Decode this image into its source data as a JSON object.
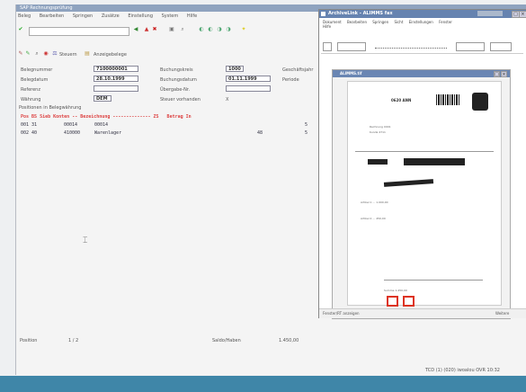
{
  "main_window": {
    "title": "SAP Rechnungsprüfung",
    "menu": [
      "Beleg",
      "Bearbeiten",
      "Springen",
      "Zusätze",
      "Einstellung",
      "System",
      "Hilfe"
    ],
    "toolbar2_label1": "Steuern",
    "toolbar2_label2": "Anzeigebelege"
  },
  "header_fields": {
    "beleg_label": "Belegnummer",
    "beleg_value": "7100000001",
    "buchungskreis_label": "Buchungskreis",
    "buchungskreis_value": "1000",
    "geschaeftsjahr_label": "Geschäftsjahr",
    "datum_label": "Belegdatum",
    "datum_value": "28.10.1999",
    "buchungsdatum_label": "Buchungsdatum",
    "buchungsdatum_value": "01.11.1999",
    "periode_label": "Periode",
    "referenz_label": "Referenz",
    "uebergabe_label": "Übergabe-Nr.",
    "waehrung_label": "Währung",
    "waehrung_value": "DEM",
    "steuer_label": "Steuer vorhanden",
    "steuer_value": "X",
    "positions_label": "Positionen in Belegwährung"
  },
  "table": {
    "header": "Pos BS Sieb Konten -- Bezeichnung -------------- ZS   Betrag In",
    "rows": [
      {
        "pos": "001 31",
        "konto": "00014",
        "bez": "00014",
        "zs": "",
        "betrag": "5"
      },
      {
        "pos": "002 40",
        "konto": "410000",
        "bez": "Warenlager",
        "zs": "48",
        "betrag": "5"
      }
    ]
  },
  "statusbar": {
    "pos_label": "Position",
    "pos_value": "1 / 2",
    "saldo_label": "Saldo/Haben",
    "saldo_value": "1.450,00",
    "system_info": "TCD (1) (020)  iwoalou  OVR  10:32"
  },
  "viewer": {
    "title": "ArchiveLink - ALIMMS fax",
    "menu": [
      "Dokument",
      "Bearbeiten",
      "Springen",
      "Sicht",
      "Einstellungen",
      "Fenster",
      "Hilfe"
    ],
    "inner_title": "ALIMMS.tif",
    "footer_label": "Fenster/RT anzeigen",
    "footer_right": "Weitere"
  },
  "document": {
    "invoice_no": "0620 ANN",
    "lines": [
      "Rechnung 0001",
      "Kunde 4711",
      "Artikel 1 ... 1.000,00",
      "Artikel 2 ... 450,00",
      "Summe 1.450,00"
    ]
  },
  "colors": {
    "taskbar": "#3f86a8",
    "titlebar": "#6683b0",
    "table_header": "#dd4444"
  },
  "icons": [
    "check-icon",
    "open-folder-icon",
    "save-icon",
    "print-icon",
    "find-icon",
    "help-icon"
  ]
}
